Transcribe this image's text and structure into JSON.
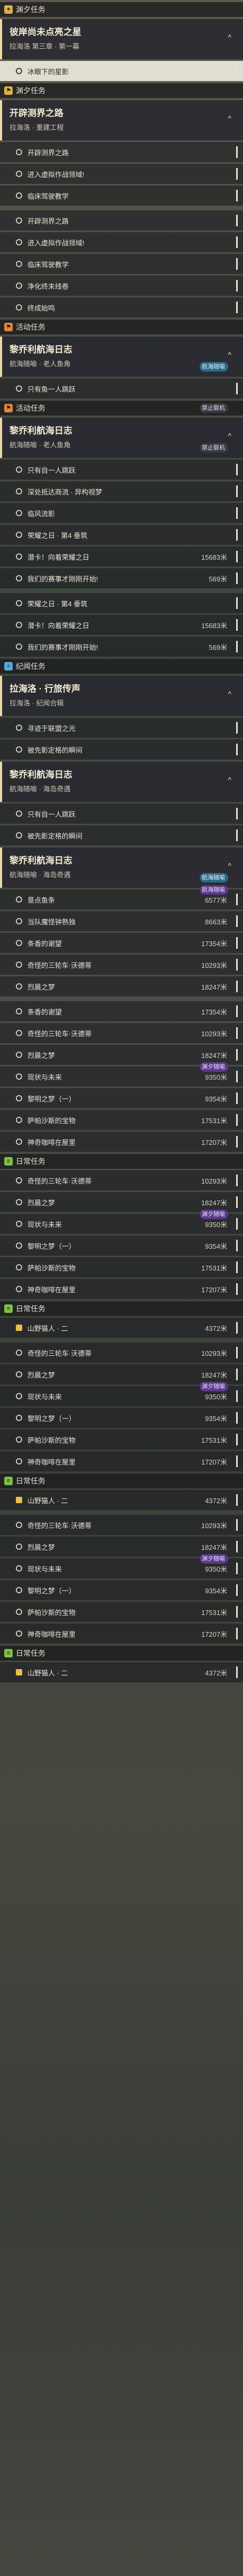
{
  "sections": [
    {
      "type": "header",
      "title": "渊夕任务",
      "tone": "gold",
      "icon": "spark-icon"
    },
    {
      "type": "card",
      "title": "彼岸尚未点亮之星",
      "subtitle": "拉海洛 第三章 · 第一幕",
      "chevron": "^"
    },
    {
      "type": "row",
      "label": "冰眼下的星影",
      "highlight": true
    },
    {
      "type": "header",
      "title": "渊夕任务",
      "tone": "gold",
      "icon": "pin-icon"
    },
    {
      "type": "card",
      "title": "开辟测界之路",
      "subtitle": "拉海洛 · 重建工程",
      "chevron": "^"
    },
    {
      "type": "row",
      "label": "开辟测界之路"
    },
    {
      "type": "row",
      "label": "进入虚拟作战领域!"
    },
    {
      "type": "row",
      "label": "临床驾驶教学"
    },
    {
      "type": "gap"
    },
    {
      "type": "row",
      "label": "开辟测界之路",
      "value": ""
    },
    {
      "type": "row",
      "label": "进入虚拟作战领域!"
    },
    {
      "type": "row",
      "label": "临床驾驶教学"
    },
    {
      "type": "row",
      "label": "净化终末线卷"
    },
    {
      "type": "row",
      "label": "终成始鸣"
    },
    {
      "type": "header",
      "title": "活动任务",
      "tone": "orange",
      "icon": "flag-icon"
    },
    {
      "type": "card",
      "title": "黎乔利航海日志",
      "subtitle": "航海随喻 · 老人鱼角",
      "chevron": "^",
      "tag": "航海随喻",
      "tagTone": "blue"
    },
    {
      "type": "row",
      "label": "只有鱼一人跳跃"
    },
    {
      "type": "header",
      "title": "活动任务",
      "tone": "orange",
      "icon": "flag-icon",
      "tag": "禁止联机",
      "tagTone": "gray"
    },
    {
      "type": "card",
      "title": "黎乔利航海日志",
      "subtitle": "航海随喻 · 老人鱼角",
      "chevron": "^",
      "tag": "禁止联机",
      "tagTone": "gray"
    },
    {
      "type": "row",
      "label": "只有自一人跳跃"
    },
    {
      "type": "row",
      "label": "深处抵达商流 · 异构视梦"
    },
    {
      "type": "row",
      "label": "临风流影"
    },
    {
      "type": "row",
      "label": "荣耀之日 · 第4 垂筑"
    },
    {
      "type": "row",
      "label": "潜卡！向着荣耀之日",
      "value": "15683米"
    },
    {
      "type": "row",
      "label": "我们的赛事才刚刚开始!",
      "value": "569米"
    },
    {
      "type": "gap"
    },
    {
      "type": "row",
      "label": "荣耀之日 · 第4 垂筑"
    },
    {
      "type": "row",
      "label": "潜卡！向着荣耀之日",
      "value": "15683米"
    },
    {
      "type": "row",
      "label": "我们的赛事才刚刚开始!",
      "value": "569米"
    },
    {
      "type": "header",
      "title": "纪闻任务",
      "tone": "blue",
      "icon": "plus-icon"
    },
    {
      "type": "card",
      "title": "拉海洛 · 行旅传声",
      "subtitle": "拉海洛 · 纪闻合辑",
      "chevron": "^"
    },
    {
      "type": "row",
      "label": "寻迹于联盟之光"
    },
    {
      "type": "row",
      "label": "被先影定格的瞬间"
    },
    {
      "type": "card",
      "title": "黎乔利航海日志",
      "subtitle": "航海随喻 · 海岛奇遇",
      "chevron": "^"
    },
    {
      "type": "row",
      "label": "只有自一人跳跃"
    },
    {
      "type": "row",
      "label": "被先影定格的瞬间"
    },
    {
      "type": "card",
      "title": "黎乔利航海日志",
      "subtitle": "航海随喻 · 海岛奇遇",
      "chevron": "^",
      "tag": "航海随喻",
      "tagTone": "blue"
    },
    {
      "type": "row",
      "label": "垦点鱼条",
      "value": "6577米",
      "tag": "航海随喻"
    },
    {
      "type": "row",
      "label": "当队魔怪钟熟独",
      "value": "8663米"
    },
    {
      "type": "row",
      "label": "条香的谢望",
      "value": "17354米"
    },
    {
      "type": "row",
      "label": "奇怪的三轮车·沃德蒂",
      "value": "10293米"
    },
    {
      "type": "row",
      "label": "烈晨之梦",
      "value": "18247米"
    },
    {
      "type": "gap"
    },
    {
      "type": "row",
      "label": "条香的谢望",
      "value": "17354米"
    },
    {
      "type": "row",
      "label": "奇怪的三轮车·沃德蒂",
      "value": "10293米"
    },
    {
      "type": "row",
      "label": "烈晨之梦",
      "value": "18247米"
    },
    {
      "type": "row",
      "label": "现状与未来",
      "value": "9350米",
      "tag": "渊夕随喻"
    },
    {
      "type": "row",
      "label": "黎明之梦（一）",
      "value": "9354米"
    },
    {
      "type": "row",
      "label": "萨帕沙斯的宝物",
      "value": "17531米"
    },
    {
      "type": "row",
      "label": "神奇咖啡在屋里",
      "value": "17207米"
    },
    {
      "type": "header",
      "title": "日常任务",
      "tone": "green",
      "icon": "list-icon"
    },
    {
      "type": "row",
      "label": "奇怪的三轮车·沃德蒂",
      "value": "10293米"
    },
    {
      "type": "row",
      "label": "烈晨之梦",
      "value": "18247米"
    },
    {
      "type": "row",
      "label": "现状与未来",
      "value": "9350米",
      "tag": "渊夕随喻"
    },
    {
      "type": "row",
      "label": "黎明之梦（一）",
      "value": "9354米"
    },
    {
      "type": "row",
      "label": "萨帕沙斯的宝物",
      "value": "17531米"
    },
    {
      "type": "row",
      "label": "神奇咖啡在屋里",
      "value": "17207米"
    },
    {
      "type": "header",
      "title": "日常任务",
      "tone": "green",
      "icon": "list-icon"
    },
    {
      "type": "row",
      "label": "山野猫人 · 二",
      "value": "4372米",
      "square": "gold"
    },
    {
      "type": "gap"
    },
    {
      "type": "row",
      "label": "奇怪的三轮车·沃德蒂",
      "value": "10293米"
    },
    {
      "type": "row",
      "label": "烈晨之梦",
      "value": "18247米"
    },
    {
      "type": "row",
      "label": "现状与未来",
      "value": "9350米",
      "tag": "渊夕随喻"
    },
    {
      "type": "row",
      "label": "黎明之梦（一）",
      "value": "9354米"
    },
    {
      "type": "row",
      "label": "萨帕沙斯的宝物",
      "value": "17531米"
    },
    {
      "type": "row",
      "label": "神奇咖啡在屋里",
      "value": "17207米"
    },
    {
      "type": "header",
      "title": "日常任务",
      "tone": "green",
      "icon": "list-icon"
    },
    {
      "type": "row",
      "label": "山野猫人 · 二",
      "value": "4372米",
      "square": "gold"
    },
    {
      "type": "gap"
    },
    {
      "type": "row",
      "label": "奇怪的三轮车·沃德蒂",
      "value": "10293米"
    },
    {
      "type": "row",
      "label": "烈晨之梦",
      "value": "18247米"
    },
    {
      "type": "row",
      "label": "现状与未来",
      "value": "9350米",
      "tag": "渊夕随喻"
    },
    {
      "type": "row",
      "label": "黎明之梦（一）",
      "value": "9354米"
    },
    {
      "type": "row",
      "label": "萨帕沙斯的宝物",
      "value": "17531米"
    },
    {
      "type": "row",
      "label": "神奇咖啡在屋里",
      "value": "17207米"
    },
    {
      "type": "header",
      "title": "日常任务",
      "tone": "green",
      "icon": "list-icon"
    },
    {
      "type": "row",
      "label": "山野猫人 · 二",
      "value": "4372米",
      "square": "gold"
    }
  ]
}
